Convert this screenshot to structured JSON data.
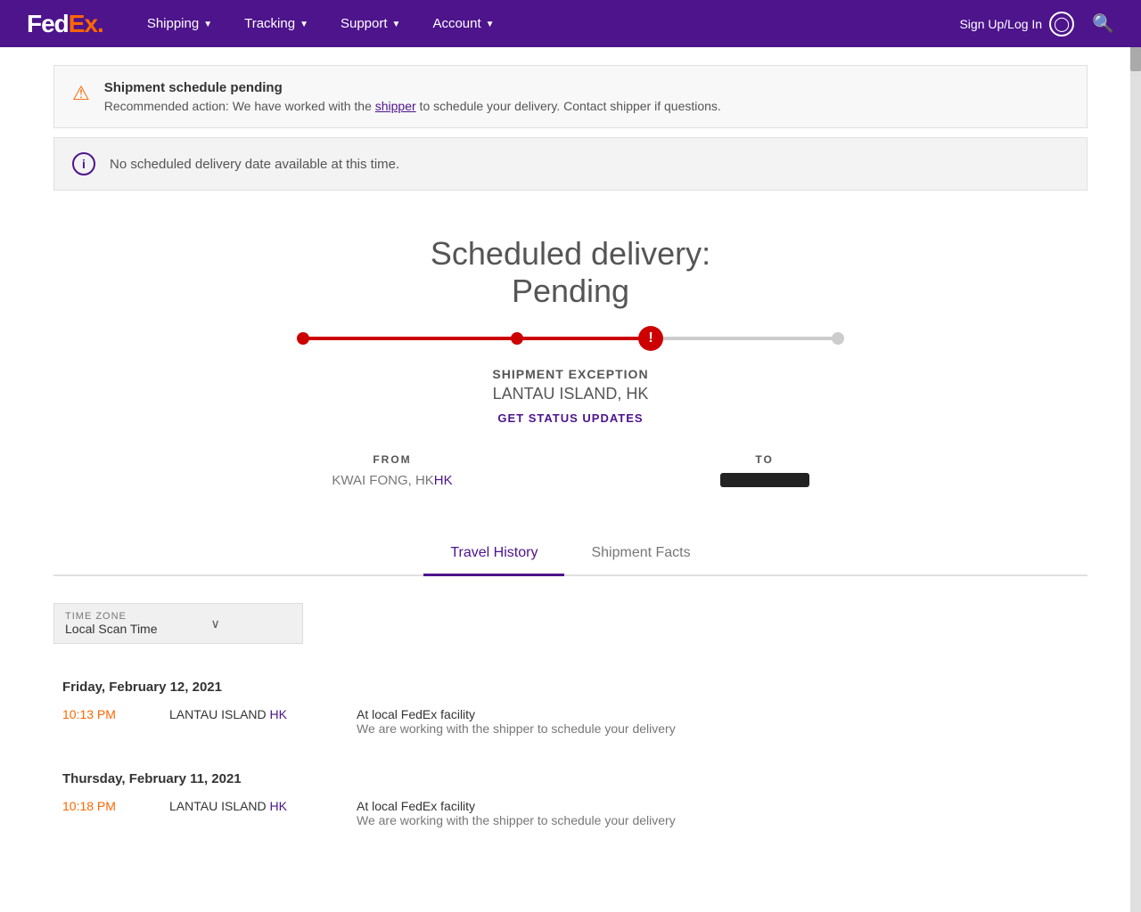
{
  "header": {
    "logo_fed": "Fed",
    "logo_ex": "Ex",
    "logo_dot": ".",
    "nav_items": [
      {
        "label": "Shipping",
        "has_chevron": true
      },
      {
        "label": "Tracking",
        "has_chevron": true
      },
      {
        "label": "Support",
        "has_chevron": true
      },
      {
        "label": "Account",
        "has_chevron": true
      }
    ],
    "sign_in_label": "Sign Up/Log In",
    "search_label": "Search"
  },
  "alert": {
    "title": "Shipment schedule pending",
    "body_prefix": "Recommended action: We have worked with the ",
    "body_link": "shipper",
    "body_suffix": " to schedule your delivery. Contact shipper if questions."
  },
  "info_banner": {
    "text": "No scheduled delivery date available at this time."
  },
  "delivery": {
    "title": "Scheduled delivery:",
    "status": "Pending"
  },
  "progress": {
    "dots": [
      {
        "id": "dot1",
        "type": "filled"
      },
      {
        "id": "dot2",
        "type": "filled"
      },
      {
        "id": "dot3",
        "type": "exception",
        "symbol": "!"
      },
      {
        "id": "dot4",
        "type": "empty"
      }
    ]
  },
  "shipment": {
    "exception_label": "SHIPMENT EXCEPTION",
    "location": "LANTAU ISLAND, HK",
    "status_link": "GET STATUS UPDATES"
  },
  "from_to": {
    "from_label": "FROM",
    "from_location_name": "KWAI FONG, HK",
    "from_location_country": "HK",
    "to_label": "TO",
    "to_redacted": true
  },
  "tabs": [
    {
      "label": "Travel History",
      "active": true
    },
    {
      "label": "Shipment Facts",
      "active": false
    }
  ],
  "timezone": {
    "label": "TIME ZONE",
    "value": "Local Scan Time",
    "chevron": "∨"
  },
  "travel_history": [
    {
      "date": "Friday, February 12, 2021",
      "entries": [
        {
          "time": "10:13 PM",
          "location_name": "LANTAU ISLAND",
          "location_country": " HK",
          "desc_main": "At local FedEx facility",
          "desc_sub": "We are working with the shipper to schedule your delivery"
        }
      ]
    },
    {
      "date": "Thursday, February 11, 2021",
      "entries": [
        {
          "time": "10:18 PM",
          "location_name": "LANTAU ISLAND",
          "location_country": " HK",
          "desc_main": "At local FedEx facility",
          "desc_sub": "We are working with the shipper to schedule your delivery"
        }
      ]
    }
  ]
}
